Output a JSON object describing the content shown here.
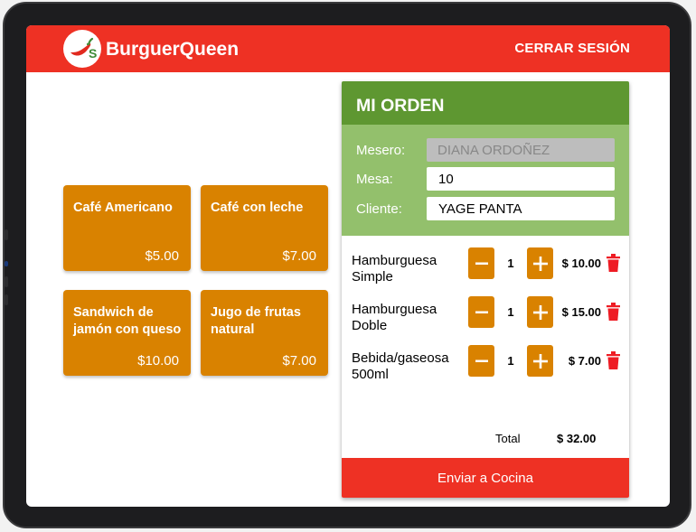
{
  "header": {
    "brand": "BurguerQueen",
    "logout_label": "CERRAR SESIÓN"
  },
  "menu": {
    "products": [
      {
        "name": "Café Americano",
        "price": "$5.00"
      },
      {
        "name": "Café con leche",
        "price": "$7.00"
      },
      {
        "name": "Sandwich de jamón con queso",
        "price": "$10.00"
      },
      {
        "name": "Jugo de frutas natural",
        "price": "$7.00"
      }
    ]
  },
  "order": {
    "title": "MI ORDEN",
    "fields": {
      "waiter_label": "Mesero:",
      "waiter_value": "DIANA ORDOÑEZ",
      "table_label": "Mesa:",
      "table_value": "10",
      "client_label": "Cliente:",
      "client_value": "YAGE PANTA"
    },
    "items": [
      {
        "name": "Hamburguesa Simple",
        "qty": "1",
        "price": "$ 10.00"
      },
      {
        "name": "Hamburguesa Doble",
        "qty": "1",
        "price": "$ 15.00"
      },
      {
        "name": "Bebida/gaseosa 500ml",
        "qty": "1",
        "price": "$ 7.00"
      }
    ],
    "total_label": "Total",
    "total_value": "$ 32.00",
    "send_label": "Enviar a Cocina"
  },
  "colors": {
    "header_red": "#ee3124",
    "product_orange": "#d98200",
    "order_green_dark": "#5e9731",
    "order_green_light": "#93c06c",
    "trash_red": "#ee1c24"
  },
  "icons": {
    "logo": "chili-pepper-logo",
    "decrement": "minus-icon",
    "increment": "plus-icon",
    "delete": "trash-icon"
  }
}
